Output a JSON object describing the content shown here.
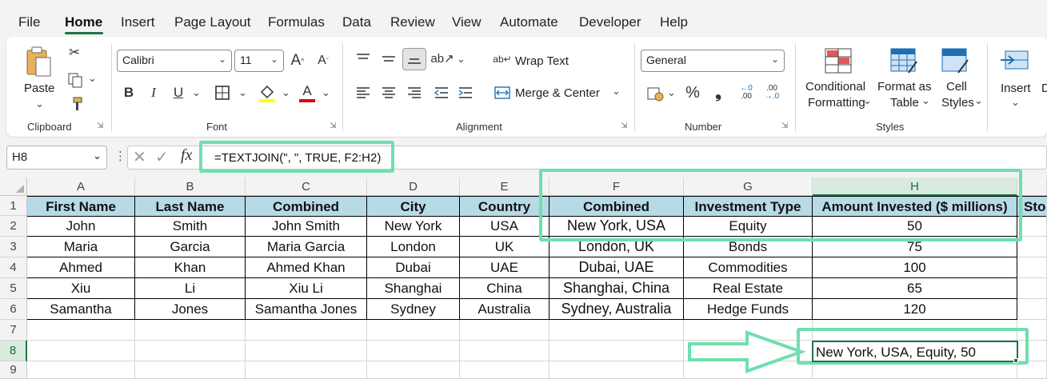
{
  "menu": {
    "items": [
      "File",
      "Home",
      "Insert",
      "Page Layout",
      "Formulas",
      "Data",
      "Review",
      "View",
      "Automate",
      "Developer",
      "Help"
    ],
    "active": "Home"
  },
  "ribbon": {
    "clipboard": {
      "label": "Clipboard",
      "paste": "Paste"
    },
    "font": {
      "label": "Font",
      "family": "Calibri",
      "size": "11"
    },
    "alignment": {
      "label": "Alignment",
      "wrap_text": "Wrap Text",
      "merge_center": "Merge & Center"
    },
    "number": {
      "label": "Number",
      "format": "General"
    },
    "styles": {
      "label": "Styles",
      "conditional_1": "Conditional",
      "conditional_2": "Formatting",
      "format_table_1": "Format as",
      "format_table_2": "Table",
      "cell_styles_1": "Cell",
      "cell_styles_2": "Styles"
    },
    "cells": {
      "insert": "Insert"
    }
  },
  "formula_bar": {
    "name_box": "H8",
    "formula": "=TEXTJOIN(\", \", TRUE, F2:H2)"
  },
  "sheet": {
    "columns": [
      "A",
      "B",
      "C",
      "D",
      "E",
      "F",
      "G",
      "H"
    ],
    "rows": [
      "1",
      "2",
      "3",
      "4",
      "5",
      "6",
      "7",
      "8",
      "9"
    ],
    "headers": [
      "First Name",
      "Last Name",
      "Combined",
      "City",
      "Country",
      "Combined",
      "Investment Type",
      "Amount Invested ($ millions)"
    ],
    "header_overflow": "Sto",
    "data": [
      [
        "John",
        "Smith",
        "John Smith",
        "New York",
        "USA",
        "New York, USA",
        "Equity",
        "50"
      ],
      [
        "Maria",
        "Garcia",
        "Maria Garcia",
        "London",
        "UK",
        "London, UK",
        "Bonds",
        "75"
      ],
      [
        "Ahmed",
        "Khan",
        "Ahmed Khan",
        "Dubai",
        "UAE",
        "Dubai, UAE",
        "Commodities",
        "100"
      ],
      [
        "Xiu",
        "Li",
        "Xiu Li",
        "Shanghai",
        "China",
        "Shanghai, China",
        "Real Estate",
        "65"
      ],
      [
        "Samantha",
        "Jones",
        "Samantha Jones",
        "Sydney",
        "Australia",
        "Sydney, Australia",
        "Hedge Funds",
        "120"
      ]
    ],
    "result_cell_value": "New York, USA, Equity, 50"
  },
  "colors": {
    "accent": "#217346",
    "highlight": "#6fdfae",
    "header_fill": "#b7dbe6"
  }
}
